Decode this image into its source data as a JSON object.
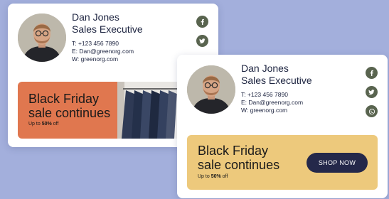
{
  "signature_back": {
    "name": "Dan Jones",
    "role": "Sales Executive",
    "phone": "T: +123 456 7890",
    "email": "E: Dan@greenorg.com",
    "website": "W: greenorg.com",
    "socials": [
      "facebook-icon",
      "twitter-icon"
    ],
    "banner": {
      "title_line1": "Black Friday",
      "title_line2": "sale continues",
      "sub_prefix": "Up to ",
      "sub_bold": "50%",
      "sub_suffix": " off",
      "color": "#e0774f"
    }
  },
  "signature_front": {
    "name": "Dan Jones",
    "role": "Sales Executive",
    "phone": "T: +123 456 7890",
    "email": "E: Dan@greenorg.com",
    "website": "W: greenorg.com",
    "socials": [
      "facebook-icon",
      "twitter-icon",
      "whatsapp-icon"
    ],
    "banner": {
      "title_line1": "Black Friday",
      "title_line2": "sale continues",
      "sub_prefix": "Up to ",
      "sub_bold": "50%",
      "sub_suffix": " off",
      "button_label": "SHOP NOW",
      "color": "#edc97c",
      "button_color": "#24284a"
    }
  },
  "colors": {
    "background": "#a3afdc",
    "social_icon_bg": "#59644f",
    "text": "#1d2440"
  }
}
